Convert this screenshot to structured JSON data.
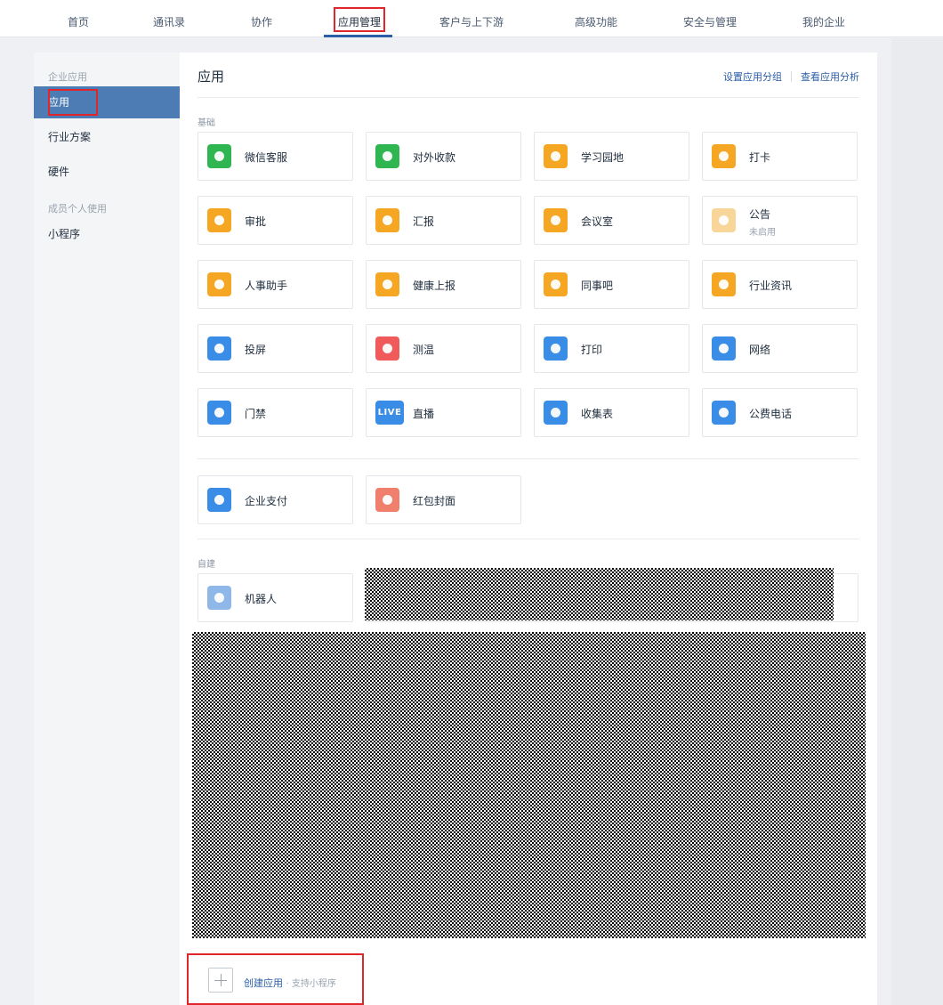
{
  "nav": {
    "items": [
      {
        "label": "首页"
      },
      {
        "label": "通讯录"
      },
      {
        "label": "协作"
      },
      {
        "label": "应用管理"
      },
      {
        "label": "客户与上下游"
      },
      {
        "label": "高级功能"
      },
      {
        "label": "安全与管理"
      },
      {
        "label": "我的企业"
      }
    ],
    "active": "应用管理"
  },
  "sidebar": {
    "section1": "企业应用",
    "items1": [
      {
        "label": "应用"
      },
      {
        "label": "行业方案"
      },
      {
        "label": "硬件"
      }
    ],
    "section2": "成员个人使用",
    "items2": [
      {
        "label": "小程序"
      }
    ],
    "active": "应用"
  },
  "main": {
    "title": "应用",
    "links": {
      "group": "设置应用分组",
      "analytics": "查看应用分析"
    },
    "basic_label": "基础",
    "basic_apps": [
      {
        "label": "微信客服",
        "icon": "wechat-chat-icon",
        "color": "#2fb650"
      },
      {
        "label": "对外收款",
        "icon": "yuan-shield-icon",
        "color": "#2fb650"
      },
      {
        "label": "学习园地",
        "icon": "planet-icon",
        "color": "#f5a623"
      },
      {
        "label": "打卡",
        "icon": "location-pin-icon",
        "color": "#f5a623"
      },
      {
        "label": "审批",
        "icon": "stamp-icon",
        "color": "#f5a623"
      },
      {
        "label": "汇报",
        "icon": "report-doc-icon",
        "color": "#f5a623"
      },
      {
        "label": "会议室",
        "icon": "door-icon",
        "color": "#f5a623"
      },
      {
        "label": "公告",
        "sub": "未启用",
        "icon": "megaphone-icon",
        "color": "#f8d69a"
      },
      {
        "label": "人事助手",
        "icon": "person-icon",
        "color": "#f5a623"
      },
      {
        "label": "健康上报",
        "icon": "health-clipboard-icon",
        "color": "#f5a623"
      },
      {
        "label": "同事吧",
        "icon": "community-icon",
        "color": "#f5a623"
      },
      {
        "label": "行业资讯",
        "icon": "news-icon",
        "color": "#f5a623"
      },
      {
        "label": "投屏",
        "icon": "screen-cast-icon",
        "color": "#3a8de6"
      },
      {
        "label": "测温",
        "icon": "thermometer-icon",
        "color": "#f05a5a"
      },
      {
        "label": "打印",
        "icon": "printer-icon",
        "color": "#3a8de6"
      },
      {
        "label": "网络",
        "icon": "wifi-router-icon",
        "color": "#3a8de6"
      },
      {
        "label": "门禁",
        "icon": "door-access-icon",
        "color": "#3a8de6"
      },
      {
        "label": "直播",
        "icon": "live-icon",
        "color": "#3a8de6",
        "glyph": "LIVE"
      },
      {
        "label": "收集表",
        "icon": "form-tray-icon",
        "color": "#3a8de6"
      },
      {
        "label": "公费电话",
        "icon": "phone-icon",
        "color": "#3a8de6"
      }
    ],
    "pay_apps": [
      {
        "label": "企业支付",
        "icon": "payment-check-icon",
        "color": "#3a8de6"
      },
      {
        "label": "红包封面",
        "icon": "red-envelope-icon",
        "color": "#f07f6e"
      }
    ],
    "custom_label": "自建",
    "custom_apps": [
      {
        "label": "机器人",
        "icon": "robot-icon",
        "color": "#8fb8e8"
      }
    ],
    "create": {
      "label": "创建应用",
      "hint": "· 支持小程序"
    }
  }
}
